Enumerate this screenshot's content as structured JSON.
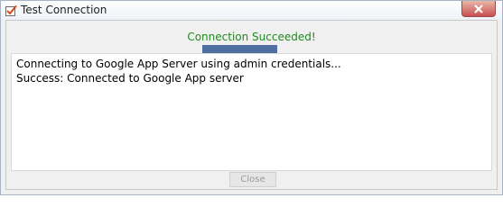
{
  "window": {
    "title": "Test Connection",
    "title_icon": "checklist-icon",
    "close_icon": "close-icon"
  },
  "status": {
    "text": "Connection Succeeded!",
    "color": "#1f8a1f"
  },
  "progress": {
    "fraction": 1.0,
    "fill_color": "#4f6fa3"
  },
  "log": {
    "lines": [
      "Connecting to Google App Server using admin credentials...",
      "Success: Connected to Google App server"
    ]
  },
  "buttons": {
    "close_label": "Close",
    "close_enabled": false
  }
}
